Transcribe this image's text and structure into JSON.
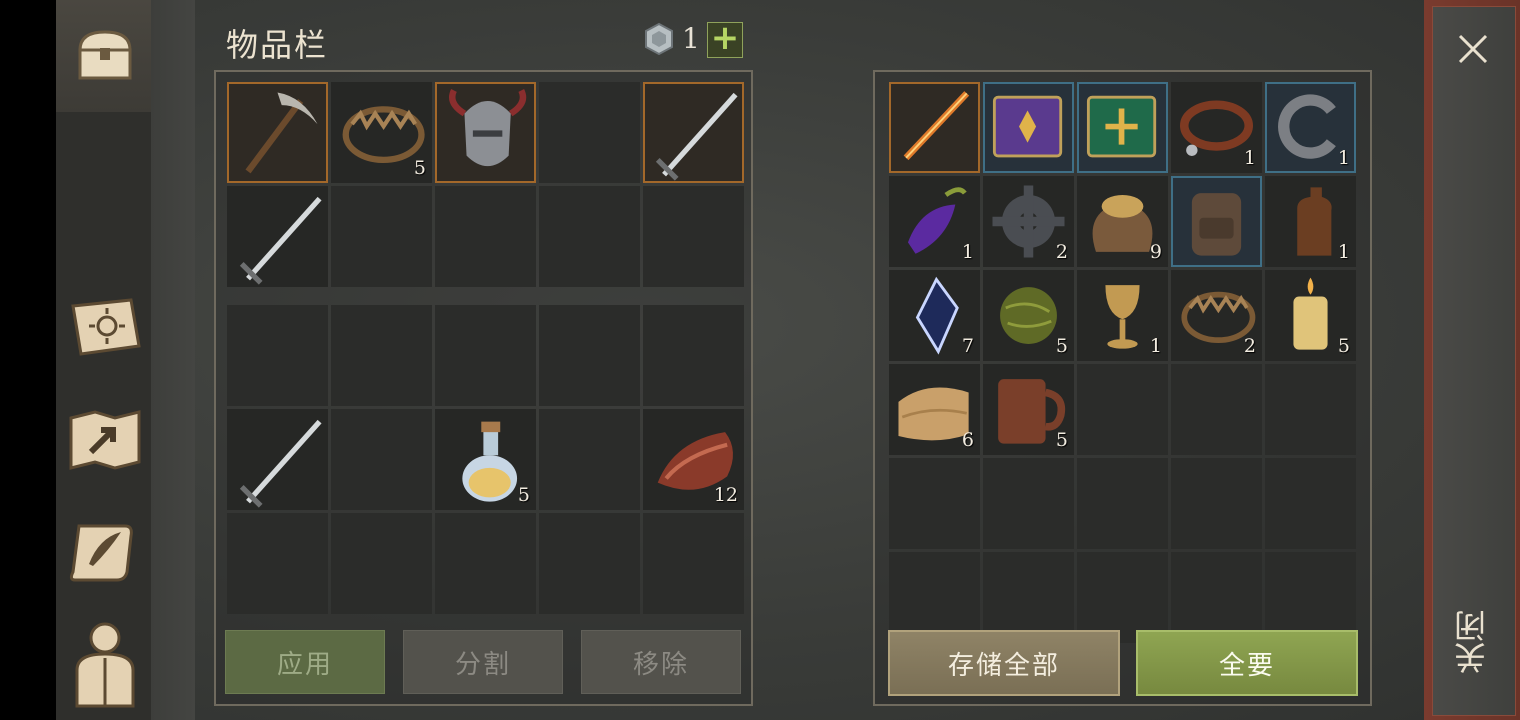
{
  "inventory": {
    "title": "物品栏",
    "currency_count": "1",
    "add_label": "+",
    "equipment_row1": [
      {
        "icon": "pickaxe-icon",
        "count": ""
      },
      {
        "icon": "bear-trap-icon",
        "count": "5"
      },
      {
        "icon": "horned-helmet-icon",
        "count": ""
      },
      {
        "icon": "",
        "count": ""
      },
      {
        "icon": "sword-icon",
        "count": ""
      }
    ],
    "equipment_row2": [
      {
        "icon": "sword-icon",
        "count": ""
      },
      {
        "icon": "",
        "count": ""
      },
      {
        "icon": "",
        "count": ""
      },
      {
        "icon": "",
        "count": ""
      },
      {
        "icon": "",
        "count": ""
      }
    ],
    "bag_rows": [
      [
        {
          "icon": "",
          "count": ""
        },
        {
          "icon": "",
          "count": ""
        },
        {
          "icon": "",
          "count": ""
        },
        {
          "icon": "",
          "count": ""
        },
        {
          "icon": "",
          "count": ""
        }
      ],
      [
        {
          "icon": "sword-icon",
          "count": ""
        },
        {
          "icon": "",
          "count": ""
        },
        {
          "icon": "potion-flask-icon",
          "count": "5"
        },
        {
          "icon": "",
          "count": ""
        },
        {
          "icon": "raw-meat-icon",
          "count": "12"
        }
      ],
      [
        {
          "icon": "",
          "count": ""
        },
        {
          "icon": "",
          "count": ""
        },
        {
          "icon": "",
          "count": ""
        },
        {
          "icon": "",
          "count": ""
        },
        {
          "icon": "",
          "count": ""
        }
      ]
    ],
    "apply_label": "应用",
    "split_label": "分割",
    "remove_label": "移除"
  },
  "storage": {
    "rows": [
      [
        {
          "icon": "flaming-sword-icon",
          "count": ""
        },
        {
          "icon": "purple-book-icon",
          "count": ""
        },
        {
          "icon": "green-book-icon",
          "count": ""
        },
        {
          "icon": "leather-collar-icon",
          "count": "1"
        },
        {
          "icon": "iron-ring-icon",
          "count": "1"
        }
      ],
      [
        {
          "icon": "purple-potion-icon",
          "count": "1"
        },
        {
          "icon": "gear-icon",
          "count": "2"
        },
        {
          "icon": "grain-sack-icon",
          "count": "9"
        },
        {
          "icon": "backpack-icon",
          "count": ""
        },
        {
          "icon": "leather-bottle-icon",
          "count": "1"
        }
      ],
      [
        {
          "icon": "crystal-shard-icon",
          "count": "7"
        },
        {
          "icon": "herb-ball-icon",
          "count": "5"
        },
        {
          "icon": "goblet-icon",
          "count": "1"
        },
        {
          "icon": "bear-trap-icon",
          "count": "2"
        },
        {
          "icon": "candle-icon",
          "count": "5"
        }
      ],
      [
        {
          "icon": "cloth-icon",
          "count": "6"
        },
        {
          "icon": "wooden-mug-icon",
          "count": "5"
        },
        {
          "icon": "",
          "count": ""
        },
        {
          "icon": "",
          "count": ""
        },
        {
          "icon": "",
          "count": ""
        }
      ],
      [
        {
          "icon": "",
          "count": ""
        },
        {
          "icon": "",
          "count": ""
        },
        {
          "icon": "",
          "count": ""
        },
        {
          "icon": "",
          "count": ""
        },
        {
          "icon": "",
          "count": ""
        }
      ],
      [
        {
          "icon": "",
          "count": ""
        },
        {
          "icon": "",
          "count": ""
        },
        {
          "icon": "",
          "count": ""
        },
        {
          "icon": "",
          "count": ""
        },
        {
          "icon": "",
          "count": ""
        }
      ]
    ],
    "store_all_label": "存储全部",
    "take_all_label": "全要"
  },
  "close_label": "关闭",
  "colors": {
    "accent_green": "#8fa552",
    "accent_tan": "#8f8366",
    "close_red": "#7a3b2e"
  }
}
